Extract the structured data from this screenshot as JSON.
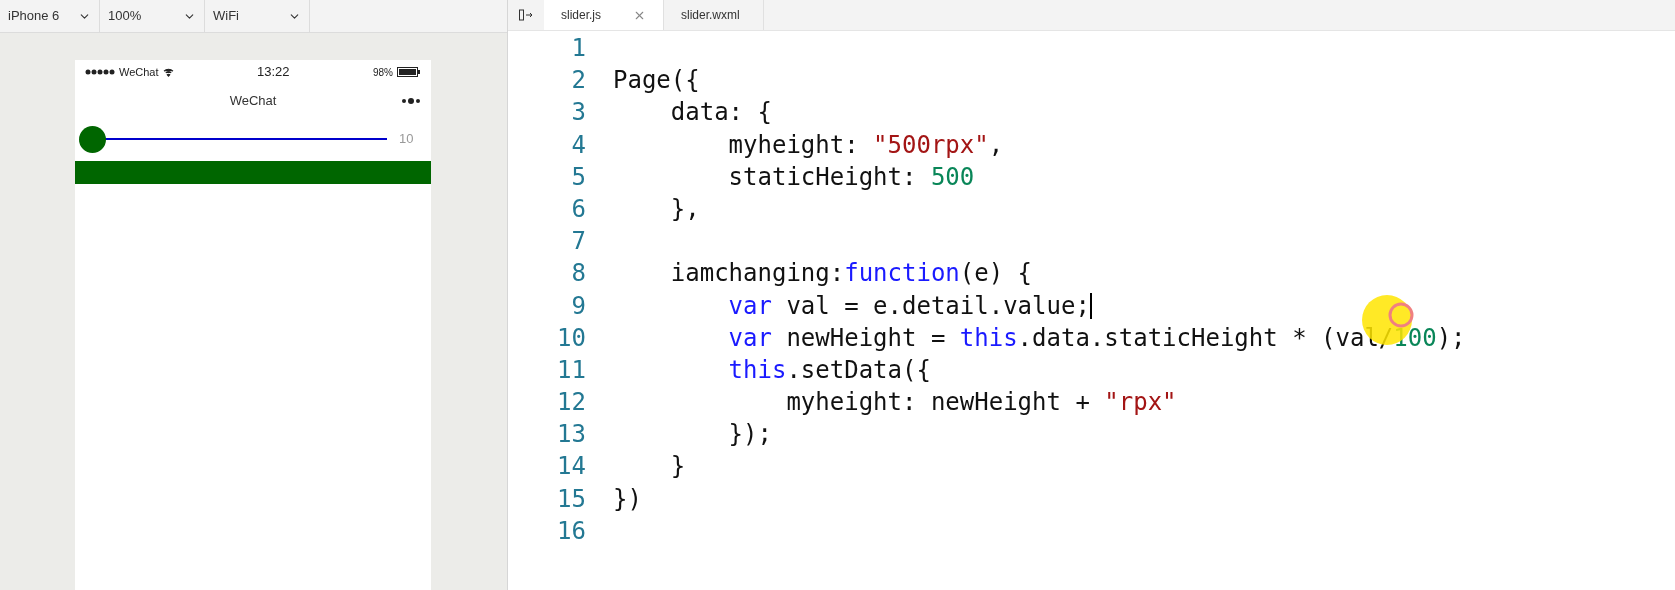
{
  "toolbar": {
    "dropdowns": [
      {
        "value": "iPhone 6"
      },
      {
        "value": "100%"
      },
      {
        "value": "WiFi"
      }
    ]
  },
  "phone": {
    "status_bar": {
      "carrier": "WeChat",
      "time": "13:22",
      "battery": "98%"
    },
    "nav_title": "WeChat",
    "slider": {
      "level": 0,
      "reading": "10"
    }
  },
  "tabs": [
    {
      "label": "slider.js",
      "selected": true,
      "closable": true
    },
    {
      "label": "slider.wxml",
      "selected": false,
      "closable": false
    }
  ],
  "code": [
    {
      "number": "1",
      "caret": false
    },
    {
      "number": "2",
      "caret": false,
      "tokens": [
        {
          "kind": "plain",
          "text": "Page({"
        }
      ]
    },
    {
      "number": "3",
      "caret": false,
      "tokens": [
        {
          "kind": "plain",
          "text": "    data: {"
        }
      ]
    },
    {
      "number": "4",
      "caret": false,
      "tokens": [
        {
          "kind": "plain",
          "text": "        myheight: "
        },
        {
          "kind": "string",
          "text": "\"500rpx\""
        },
        {
          "kind": "plain",
          "text": ","
        }
      ]
    },
    {
      "number": "5",
      "caret": false,
      "tokens": [
        {
          "kind": "plain",
          "text": "        staticHeight: "
        },
        {
          "kind": "number",
          "text": "500"
        }
      ]
    },
    {
      "number": "6",
      "caret": false,
      "tokens": [
        {
          "kind": "plain",
          "text": "    },"
        }
      ]
    },
    {
      "number": "7",
      "caret": false
    },
    {
      "number": "8",
      "caret": false,
      "tokens": [
        {
          "kind": "plain",
          "text": "    iamchanging:"
        },
        {
          "kind": "keyword",
          "text": "function"
        },
        {
          "kind": "plain",
          "text": "(e) {"
        }
      ]
    },
    {
      "number": "9",
      "caret": true,
      "tokens": [
        {
          "kind": "keyword",
          "text": "        var"
        },
        {
          "kind": "plain",
          "text": " val = e.detail.value;"
        }
      ]
    },
    {
      "number": "10",
      "caret": false,
      "tokens": [
        {
          "kind": "keyword",
          "text": "        var"
        },
        {
          "kind": "plain",
          "text": " newHeight = "
        },
        {
          "kind": "keyword",
          "text": "this"
        },
        {
          "kind": "plain",
          "text": ".data.staticHeight * (val/"
        },
        {
          "kind": "number",
          "text": "100"
        },
        {
          "kind": "plain",
          "text": ");"
        }
      ]
    },
    {
      "number": "11",
      "caret": false,
      "tokens": [
        {
          "kind": "keyword",
          "text": "        this"
        },
        {
          "kind": "plain",
          "text": ".setData({"
        }
      ]
    },
    {
      "number": "12",
      "caret": false,
      "tokens": [
        {
          "kind": "plain",
          "text": "            myheight: newHeight + "
        },
        {
          "kind": "string",
          "text": "\"rpx\""
        }
      ]
    },
    {
      "number": "13",
      "caret": false,
      "tokens": [
        {
          "kind": "plain",
          "text": "        });"
        }
      ]
    },
    {
      "number": "14",
      "caret": false,
      "tokens": [
        {
          "kind": "plain",
          "text": "    }"
        }
      ]
    },
    {
      "number": "15",
      "caret": false,
      "tokens": [
        {
          "kind": "plain",
          "text": "})"
        }
      ]
    },
    {
      "number": "16",
      "caret": false
    }
  ]
}
